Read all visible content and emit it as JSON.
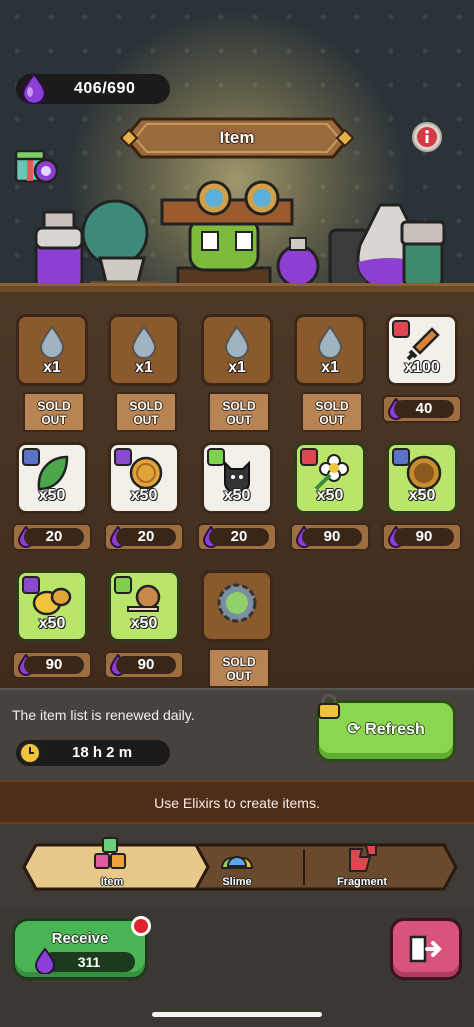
{
  "header": {
    "elixir": "406/690",
    "title": "Item"
  },
  "shop": {
    "items": [
      {
        "qty": "x1",
        "sold_label": "SOLD\nOUT",
        "sold_out": true,
        "icon": "water-drop-icon"
      },
      {
        "qty": "x1",
        "sold_label": "SOLD\nOUT",
        "sold_out": true,
        "icon": "water-drop-icon"
      },
      {
        "qty": "x1",
        "sold_label": "SOLD\nOUT",
        "sold_out": true,
        "icon": "water-drop-icon"
      },
      {
        "qty": "x1",
        "sold_label": "SOLD\nOUT",
        "sold_out": true,
        "icon": "water-drop-icon"
      },
      {
        "qty": "x100",
        "price": "40",
        "icon": "sword-icon",
        "badge": "sword-badge"
      },
      {
        "qty": "x50",
        "price": "20",
        "icon": "leaf-icon",
        "badge": "shield-badge"
      },
      {
        "qty": "x50",
        "price": "20",
        "icon": "coin-icon",
        "badge": "lightning-badge"
      },
      {
        "qty": "x50",
        "price": "20",
        "icon": "cat-icon",
        "badge": "slime-badge"
      },
      {
        "qty": "x50",
        "price": "90",
        "icon": "flower-icon",
        "badge": "sword-badge"
      },
      {
        "qty": "x50",
        "price": "90",
        "icon": "round-shield-icon",
        "badge": "shield-badge"
      },
      {
        "qty": "x50",
        "price": "90",
        "icon": "gold-chunks-icon",
        "badge": "lightning-badge"
      },
      {
        "qty": "x50",
        "price": "90",
        "icon": "snail-icon",
        "badge": "slime-badge"
      },
      {
        "qty": "",
        "sold_label": "SOLD\nOUT",
        "sold_out": true,
        "icon": "gear-slime-icon"
      }
    ]
  },
  "info": {
    "renew_text": "The item list is renewed daily.",
    "timer": "18 h 2 m",
    "refresh_label": "Refresh"
  },
  "use_text": "Use Elixirs to create items.",
  "tabs": [
    {
      "label": "Item",
      "active": true
    },
    {
      "label": "Slime",
      "active": false
    },
    {
      "label": "Fragment",
      "active": false
    }
  ],
  "bottom": {
    "receive_label": "Receive",
    "receive_amount": "311"
  },
  "colors": {
    "elixir": "#8b3fd6",
    "green_button": "#8ad64f",
    "exit_button": "#d8547a"
  }
}
